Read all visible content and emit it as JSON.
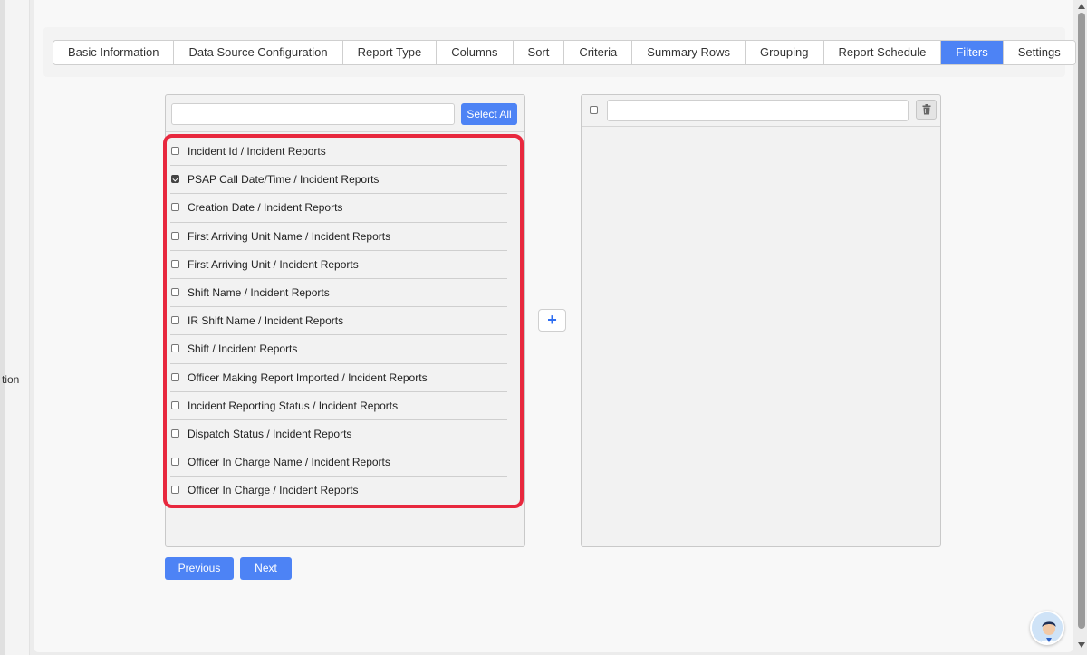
{
  "sidebar": {
    "partial_text": "tion"
  },
  "tabs": [
    {
      "label": "Basic Information",
      "active": false
    },
    {
      "label": "Data Source Configuration",
      "active": false
    },
    {
      "label": "Report Type",
      "active": false
    },
    {
      "label": "Columns",
      "active": false
    },
    {
      "label": "Sort",
      "active": false
    },
    {
      "label": "Criteria",
      "active": false
    },
    {
      "label": "Summary Rows",
      "active": false
    },
    {
      "label": "Grouping",
      "active": false
    },
    {
      "label": "Report Schedule",
      "active": false
    },
    {
      "label": "Filters",
      "active": true
    },
    {
      "label": "Settings",
      "active": false
    }
  ],
  "left_panel": {
    "search_value": "",
    "select_all_label": "Select All",
    "items": [
      {
        "label": "Incident Id / Incident Reports",
        "checked": false
      },
      {
        "label": "PSAP Call Date/Time / Incident Reports",
        "checked": true
      },
      {
        "label": "Creation Date / Incident Reports",
        "checked": false
      },
      {
        "label": "First Arriving Unit Name / Incident Reports",
        "checked": false
      },
      {
        "label": "First Arriving Unit / Incident Reports",
        "checked": false
      },
      {
        "label": "Shift Name / Incident Reports",
        "checked": false
      },
      {
        "label": "IR Shift Name / Incident Reports",
        "checked": false
      },
      {
        "label": "Shift / Incident Reports",
        "checked": false
      },
      {
        "label": "Officer Making Report Imported / Incident Reports",
        "checked": false
      },
      {
        "label": "Incident Reporting Status / Incident Reports",
        "checked": false
      },
      {
        "label": "Dispatch Status / Incident Reports",
        "checked": false
      },
      {
        "label": "Officer In Charge Name / Incident Reports",
        "checked": false
      },
      {
        "label": "Officer In Charge / Incident Reports",
        "checked": false
      }
    ]
  },
  "right_panel": {
    "search_value": "",
    "trash_icon": "trash-icon"
  },
  "add_button": {
    "symbol": "+"
  },
  "nav": {
    "previous_label": "Previous",
    "next_label": "Next"
  },
  "colors": {
    "accent": "#4d83f5",
    "highlight": "#e8283e"
  }
}
